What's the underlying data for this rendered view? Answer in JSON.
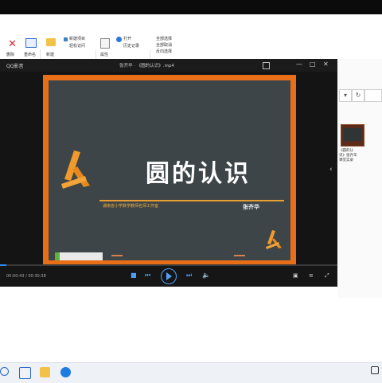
{
  "ribbon": {
    "items": [
      "删除",
      "重命名",
      "新建",
      "新建项目",
      "轻松访问",
      "属性",
      "打开",
      "历史记录",
      "全部选择",
      "全部取消",
      "反向选择"
    ]
  },
  "player": {
    "logo": "QQ影音",
    "title": "张齐华 · 《圆的认识》.mp4",
    "window_controls": [
      "—",
      "□",
      "✕"
    ],
    "slide": {
      "title": "圆的认识",
      "subtitle": "湖南省小学数学教师名师工作室",
      "author": "张齐华"
    },
    "time": "00:00:43 / 00:30:38",
    "progress": 0.02
  },
  "right_pane": {
    "thumb_caption_1": "《圆的认",
    "thumb_caption_2": "识》张齐华",
    "thumb_caption_3": "课堂实录"
  },
  "colors": {
    "accent": "#2b8cff",
    "frame": "#e86f18",
    "board": "#3e4549"
  }
}
